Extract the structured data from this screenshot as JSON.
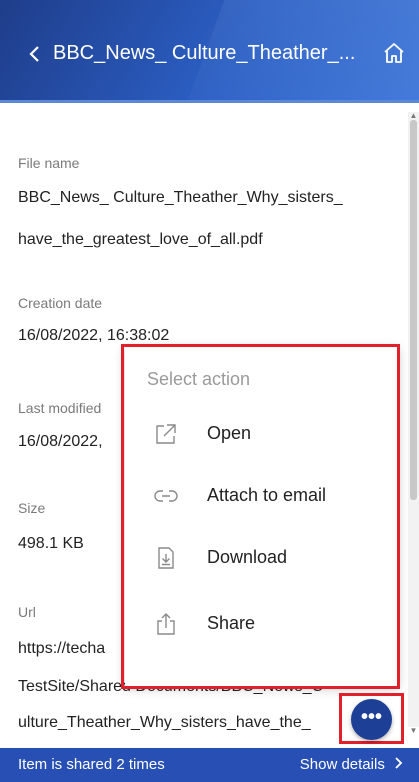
{
  "header": {
    "title": "BBC_News_ Culture_Theather_...",
    "back_icon": "chevron-left-icon",
    "home_icon": "home-icon"
  },
  "fields": {
    "file_name_label": "File name",
    "file_name_line1": "BBC_News_ Culture_Theather_Why_sisters_",
    "file_name_line2": "have_the_greatest_love_of_all.pdf",
    "creation_label": "Creation date",
    "creation_value": "16/08/2022, 16:38:02",
    "modified_label": "Last modified",
    "modified_value": "16/08/2022,",
    "size_label": "Size",
    "size_value": "498.1 KB",
    "url_label": "Url",
    "url_line1": "https://techa",
    "url_line2": "TestSite/Shared Documents/BBC_News_C",
    "url_line3": "ulture_Theather_Why_sisters_have_the_"
  },
  "menu": {
    "title": "Select action",
    "items": [
      {
        "label": "Open",
        "icon": "open-external-icon"
      },
      {
        "label": "Attach to email",
        "icon": "link-icon"
      },
      {
        "label": "Download",
        "icon": "download-icon"
      },
      {
        "label": "Share",
        "icon": "share-icon"
      }
    ]
  },
  "fab": {
    "label": "•••",
    "icon": "more-icon"
  },
  "bottom_bar": {
    "status": "Item is shared 2 times",
    "details": "Show details"
  },
  "colors": {
    "header": "#2b5fc4",
    "bottom_bar": "#2850b4",
    "fab": "#1e3f96",
    "highlight": "#e0202a"
  }
}
